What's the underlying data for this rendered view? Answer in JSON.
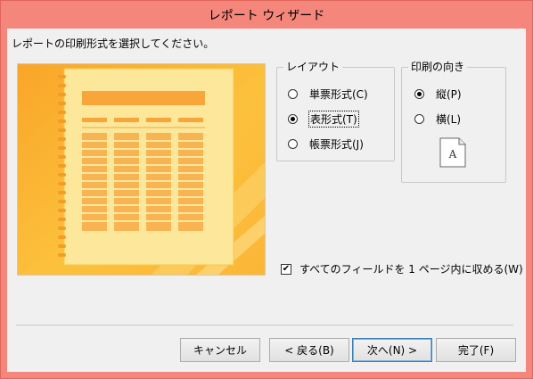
{
  "window": {
    "title": "レポート ウィザード"
  },
  "instruction": "レポートの印刷形式を選択してください。",
  "layout_group": {
    "title": "レイアウト",
    "options": [
      {
        "label": "単票形式(C)",
        "checked": false
      },
      {
        "label": "表形式(T)",
        "checked": true
      },
      {
        "label": "帳票形式(J)",
        "checked": false
      }
    ]
  },
  "orientation_group": {
    "title": "印刷の向き",
    "options": [
      {
        "label": "縦(P)",
        "checked": true
      },
      {
        "label": "横(L)",
        "checked": false
      }
    ],
    "icon_letter": "A"
  },
  "fit_fields": {
    "label": "すべてのフィールドを 1 ページ内に収める(W)",
    "checked": true
  },
  "buttons": {
    "cancel": "キャンセル",
    "back": "< 戻る(B)",
    "next": "次へ(N) >",
    "finish": "完了(F)"
  },
  "colors": {
    "title_bar": "#f4867b",
    "preview_background": "#fbb638",
    "preview_page": "#fde79a",
    "preview_table": "#f8a53a"
  }
}
